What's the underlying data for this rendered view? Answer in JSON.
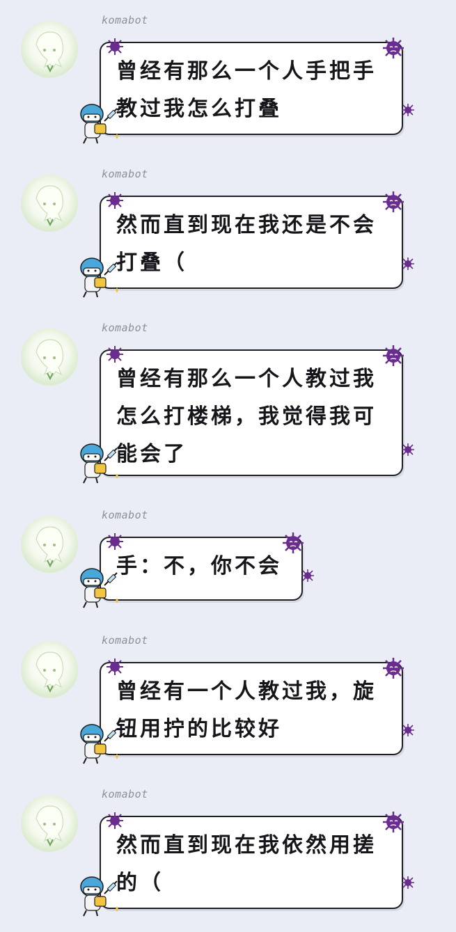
{
  "messages": [
    {
      "sender": "komabot",
      "text": "曾经有那么一个人手把手\n教过我怎么打叠"
    },
    {
      "sender": "komabot",
      "text": "然而直到现在我还是不会\n打叠（"
    },
    {
      "sender": "komabot",
      "text": "曾经有那么一个人教过我\n怎么打楼梯，我觉得我可\n能会了"
    },
    {
      "sender": "komabot",
      "text": "手：不，你不会"
    },
    {
      "sender": "komabot",
      "text": "曾经有一个人教过我，旋\n钮用拧的比较好"
    },
    {
      "sender": "komabot",
      "text": "然而直到现在我依然用搓\n的（"
    }
  ],
  "colors": {
    "background": "#eaedf6",
    "virus": "#6a2c8f",
    "nurse_cap": "#4aa7d9"
  },
  "icons": {
    "avatar": "anime-avatar-icon",
    "virus": "virus-icon",
    "nurse": "nurse-syringe-icon"
  }
}
